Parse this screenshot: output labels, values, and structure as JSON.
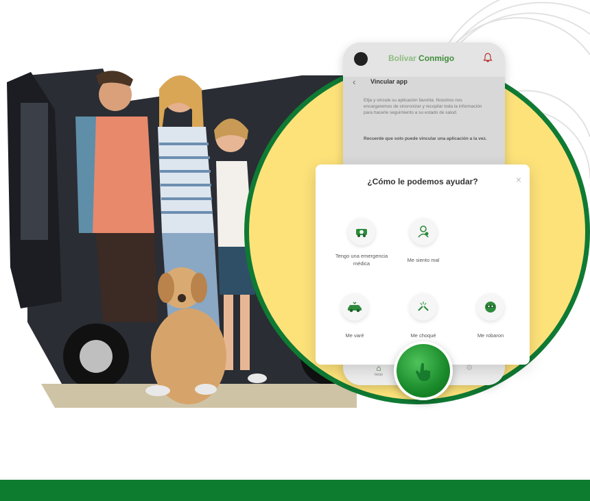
{
  "app": {
    "brand_prefix": "Bolívar",
    "brand_main": "Conmigo",
    "screen_title": "Vincular app",
    "body_text": "Elija y vincule su aplicación favorita. Nosotros nos encargaremos de sincronizar y recopilar toda la información para hacerle seguimiento a su estado de salud.",
    "note_text": "Recuerde que solo puede vincular una aplicación a la vez.",
    "nav_home_label": "Inicio"
  },
  "modal": {
    "title": "¿Cómo le podemos ayudar?",
    "close": "×",
    "options": [
      {
        "label": "Tengo una emergencia médica",
        "icon": "ambulance-icon"
      },
      {
        "label": "Me siento mal",
        "icon": "sick-person-icon"
      },
      {
        "label": "Me varé",
        "icon": "broken-car-icon"
      },
      {
        "label": "Me choqué",
        "icon": "car-crash-icon"
      },
      {
        "label": "Me robaron",
        "icon": "robbery-icon"
      }
    ]
  },
  "colors": {
    "brand_green": "#0e7c2e",
    "circle_yellow": "#fde27a",
    "circle_border": "#0f7a33"
  }
}
